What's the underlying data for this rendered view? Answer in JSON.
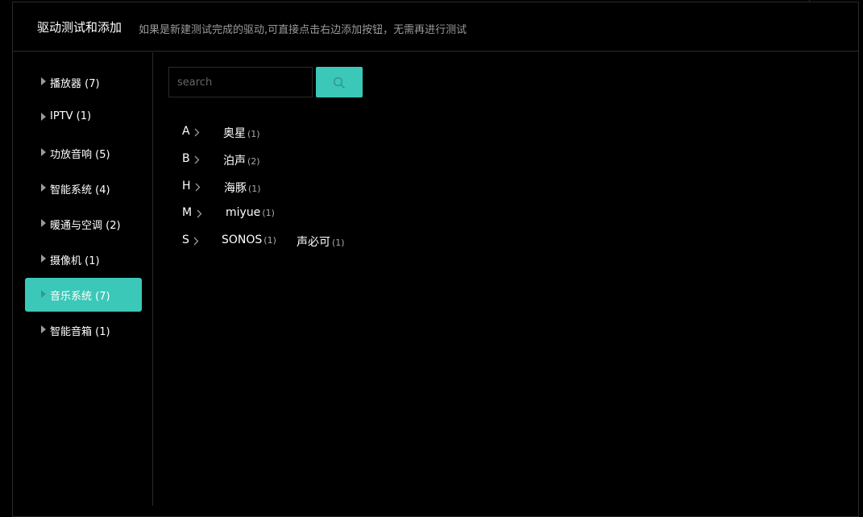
{
  "header": {
    "title": "驱动测试和添加",
    "description": "如果是新建测试完成的驱动,可直接点击右边添加按钮，无需再进行测试"
  },
  "sidebar": {
    "items": [
      {
        "label": "播放器",
        "count": "(7)",
        "active": false
      },
      {
        "label": "IPTV",
        "count": "(1)",
        "active": false
      },
      {
        "label": "功放音响",
        "count": "(5)",
        "active": false
      },
      {
        "label": "智能系统",
        "count": "(4)",
        "active": false
      },
      {
        "label": "暖通与空调",
        "count": "(2)",
        "active": false
      },
      {
        "label": "摄像机",
        "count": "(1)",
        "active": false
      },
      {
        "label": "音乐系统",
        "count": "(7)",
        "active": true
      },
      {
        "label": "智能音箱",
        "count": "(1)",
        "active": false
      }
    ]
  },
  "search": {
    "placeholder": "search",
    "value": "",
    "button_icon": "search-icon"
  },
  "colors": {
    "accent": "#3cc8b8",
    "background": "#000000",
    "border": "#2a2a2a",
    "muted_text": "#9a9a9a"
  },
  "brand_index": [
    {
      "letter": "A",
      "brands": [
        {
          "name": "奥星",
          "count": "(1)"
        }
      ]
    },
    {
      "letter": "B",
      "brands": [
        {
          "name": "泊声",
          "count": "(2)"
        }
      ]
    },
    {
      "letter": "H",
      "brands": [
        {
          "name": "海豚",
          "count": "(1)"
        }
      ]
    },
    {
      "letter": "M",
      "brands": [
        {
          "name": "miyue",
          "count": "(1)"
        }
      ]
    },
    {
      "letter": "S",
      "brands": [
        {
          "name": "SONOS",
          "count": "(1)"
        },
        {
          "name": "声必可",
          "count": "(1)"
        }
      ]
    }
  ]
}
